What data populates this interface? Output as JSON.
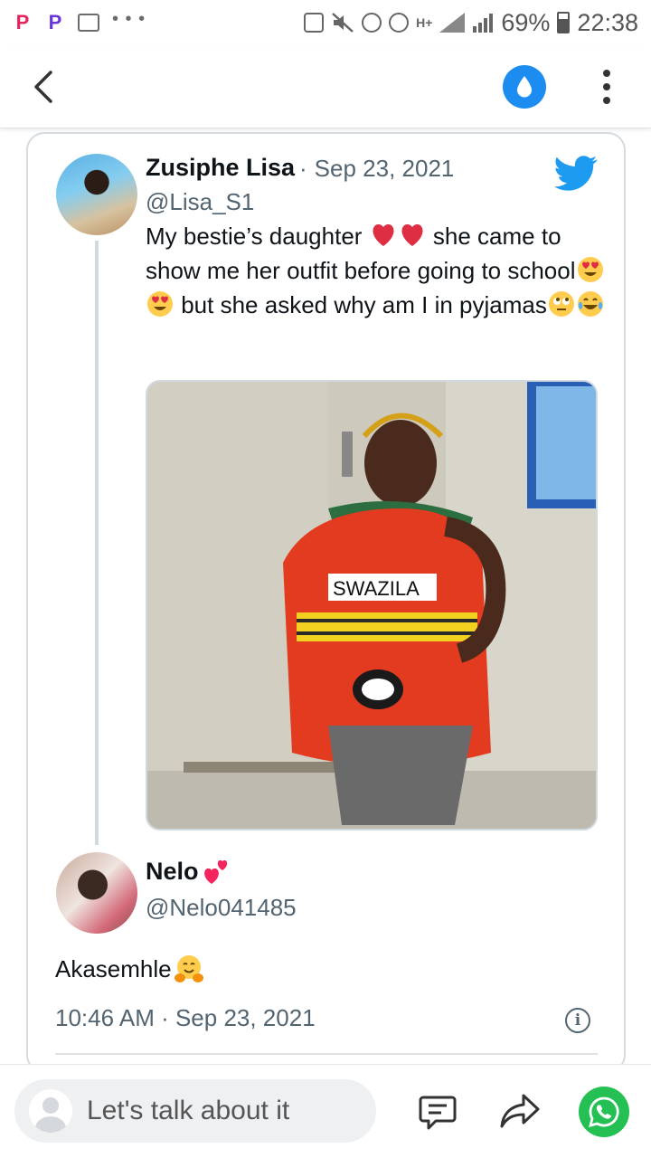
{
  "status_bar": {
    "battery": "69%",
    "time": "22:38",
    "network": "H+",
    "icons": [
      "pinterest-icon",
      "pinterest-icon",
      "image-icon",
      "more-notifications-icon",
      "sim-icon",
      "mute-icon",
      "alarm-icon",
      "data-icon",
      "network-icon",
      "signal-icon",
      "battery-icon"
    ]
  },
  "app_bar": {
    "icons": [
      "back-arrow-icon",
      "water-drop-icon",
      "more-vert-icon"
    ],
    "accent": "#1d8cf0"
  },
  "tweet": {
    "author_name": "Zusiphe Lisa",
    "date": "Sep 23, 2021",
    "date_separator": "·",
    "handle": "@Lisa_S1",
    "text_1": "My bestie’s daughter ",
    "text_2": " she came to show me her outfit before going to school",
    "text_3": " but she asked why am I in pyjamas",
    "emojis": [
      "red-heart",
      "red-heart",
      "heart-eyes",
      "heart-eyes",
      "eye-roll",
      "tears-of-joy"
    ],
    "photo_label": "SWAZILA"
  },
  "reply": {
    "author_name": "Nelo",
    "name_emoji": "two-hearts",
    "handle": "@Nelo041485",
    "text": "Akasemhle",
    "text_emoji": "hugging-face",
    "timestamp": "10:46 AM · Sep 23, 2021"
  },
  "bottom_bar": {
    "comment_placeholder": "Let's talk about it",
    "icons": [
      "comment-icon",
      "share-icon",
      "whatsapp-icon"
    ],
    "whatsapp_color": "#25c053"
  }
}
